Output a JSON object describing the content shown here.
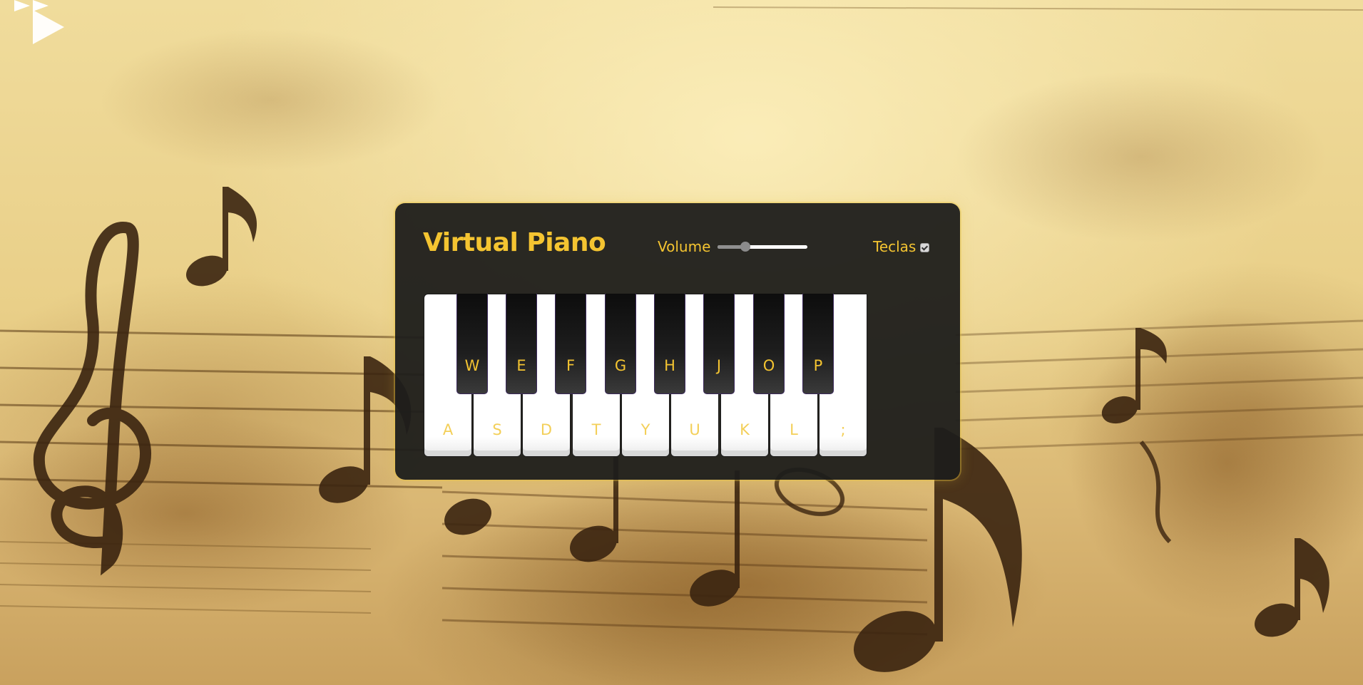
{
  "app": {
    "title": "Virtual Piano",
    "accent_color": "#f4c431",
    "panel_color": "#1e1e1b",
    "background_theme": "sepia sheet-music"
  },
  "controls": {
    "volume": {
      "label": "Volume",
      "value": 0.31
    },
    "keys_toggle": {
      "label": "Teclas",
      "checked": true
    }
  },
  "keyboard": {
    "white_keys": [
      "A",
      "S",
      "D",
      "T",
      "Y",
      "U",
      "K",
      "L",
      ";"
    ],
    "black_keys": [
      "W",
      "E",
      "F",
      "G",
      "H",
      "J",
      "O",
      "P"
    ]
  },
  "overlay": {
    "icon": "play-icon"
  }
}
